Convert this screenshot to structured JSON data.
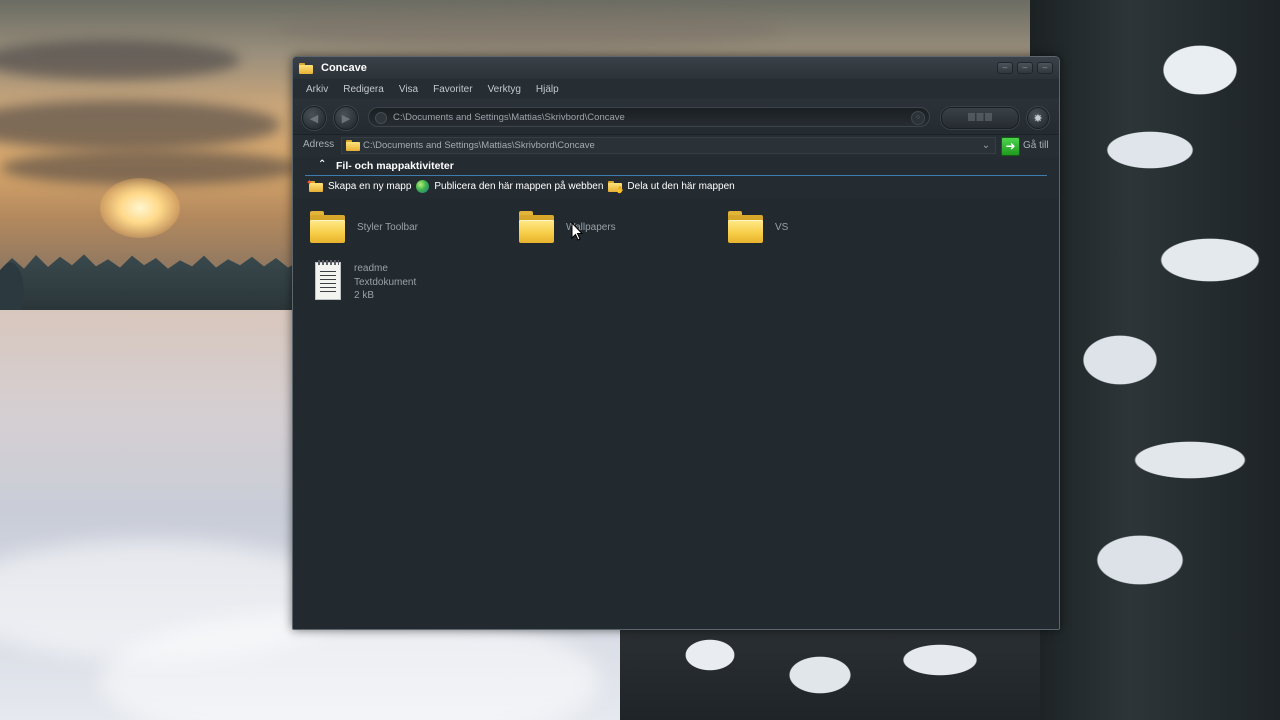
{
  "window": {
    "title": "Concave",
    "controls": [
      "minimize",
      "maximize",
      "close"
    ]
  },
  "menu": [
    "Arkiv",
    "Redigera",
    "Visa",
    "Favoriter",
    "Verktyg",
    "Hjälp"
  ],
  "navbar": {
    "path": "C:\\Documents and Settings\\Mattias\\Skrivbord\\Concave"
  },
  "address": {
    "label": "Adress",
    "value": "C:\\Documents and Settings\\Mattias\\Skrivbord\\Concave",
    "go_label": "Gå till"
  },
  "tasks": {
    "title": "Fil- och mappaktiviteter",
    "items": [
      {
        "label": "Skapa en ny mapp",
        "icon": "new-folder-icon"
      },
      {
        "label": "Publicera den här mappen på webben",
        "icon": "globe-icon"
      },
      {
        "label": "Dela ut den här mappen",
        "icon": "share-folder-icon"
      }
    ]
  },
  "files": {
    "folders": [
      {
        "name": "Styler Toolbar"
      },
      {
        "name": "Wallpapers"
      },
      {
        "name": "VS"
      }
    ],
    "document": {
      "name": "readme",
      "type": "Textdokument",
      "size": "2 kB"
    }
  },
  "colors": {
    "window_bg": "#242b31",
    "content_bg": "#222a30",
    "accent_line": "#3f7cae",
    "go_button": "#2fb52f",
    "folder": "#f6cc45"
  }
}
